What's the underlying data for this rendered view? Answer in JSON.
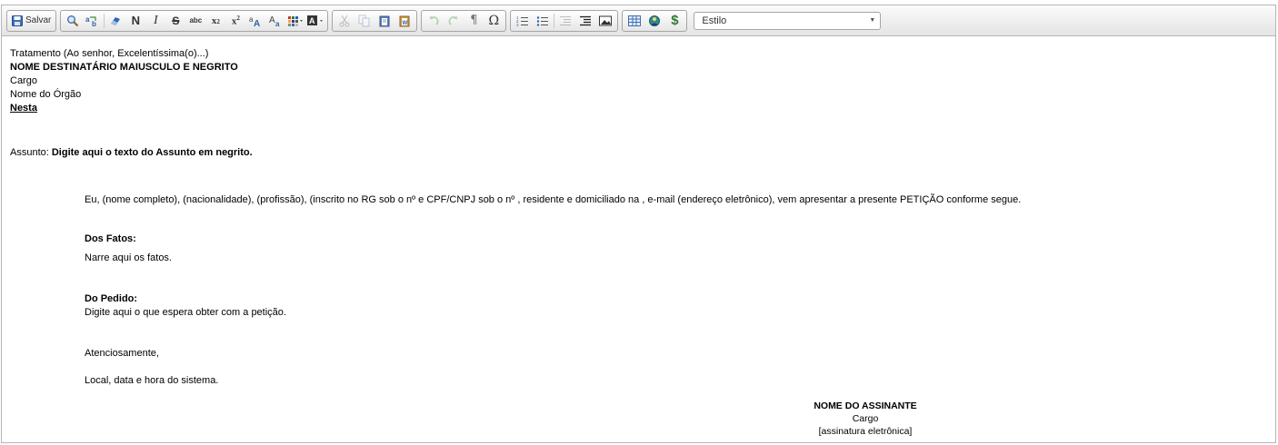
{
  "toolbar": {
    "save_label": "Salvar",
    "style_combo": {
      "value": "Estilo"
    },
    "buttons": [
      {
        "name": "find-icon",
        "glyph": "search"
      },
      {
        "name": "replace-icon",
        "glyph": "replace"
      },
      {
        "name": "remove-format-icon",
        "glyph": "eraser"
      },
      {
        "name": "bold-icon",
        "glyph": "N"
      },
      {
        "name": "italic-icon",
        "glyph": "I"
      },
      {
        "name": "strike-icon",
        "glyph": "S"
      },
      {
        "name": "small-text-icon",
        "glyph": "abc"
      },
      {
        "name": "subscript-icon",
        "glyph": "x"
      },
      {
        "name": "superscript-icon",
        "glyph": "x"
      },
      {
        "name": "font-size-decrease-icon",
        "glyph": "aA"
      },
      {
        "name": "font-size-increase-icon",
        "glyph": "Aa"
      },
      {
        "name": "table-color-icon",
        "glyph": "grid"
      },
      {
        "name": "text-color-icon",
        "glyph": "A"
      }
    ]
  },
  "document": {
    "header_lines": {
      "treatment": "Tratamento (Ao senhor, Excelentíssima(o)...)",
      "recipient": "NOME DESTINATÁRIO MAIUSCULO E NEGRITO",
      "position": "Cargo",
      "organ": "Nome do Órgão",
      "city": "Nesta"
    },
    "subject_label": "Assunto: ",
    "subject_text": "Digite aqui o texto do Assunto em negrito.",
    "intro": "Eu, (nome completo), (nacionalidade), (profissão), (inscrito no RG sob o nº e CPF/CNPJ sob o nº , residente e domiciliado na , e-mail (endereço eletrônico), vem apresentar a presente PETIÇÃO conforme segue.",
    "facts_heading": "Dos Fatos:",
    "facts_text": "Narre aqui os fatos.",
    "request_heading": "Do Pedido:",
    "request_text": "Digite aqui o que espera obter com a petição.",
    "closing": "Atenciosamente,",
    "place_date": "Local, data e hora do sistema.",
    "signer_name": "NOME DO ASSINANTE",
    "signer_position": "Cargo",
    "signature_note": "[assinatura eletrônica]"
  }
}
